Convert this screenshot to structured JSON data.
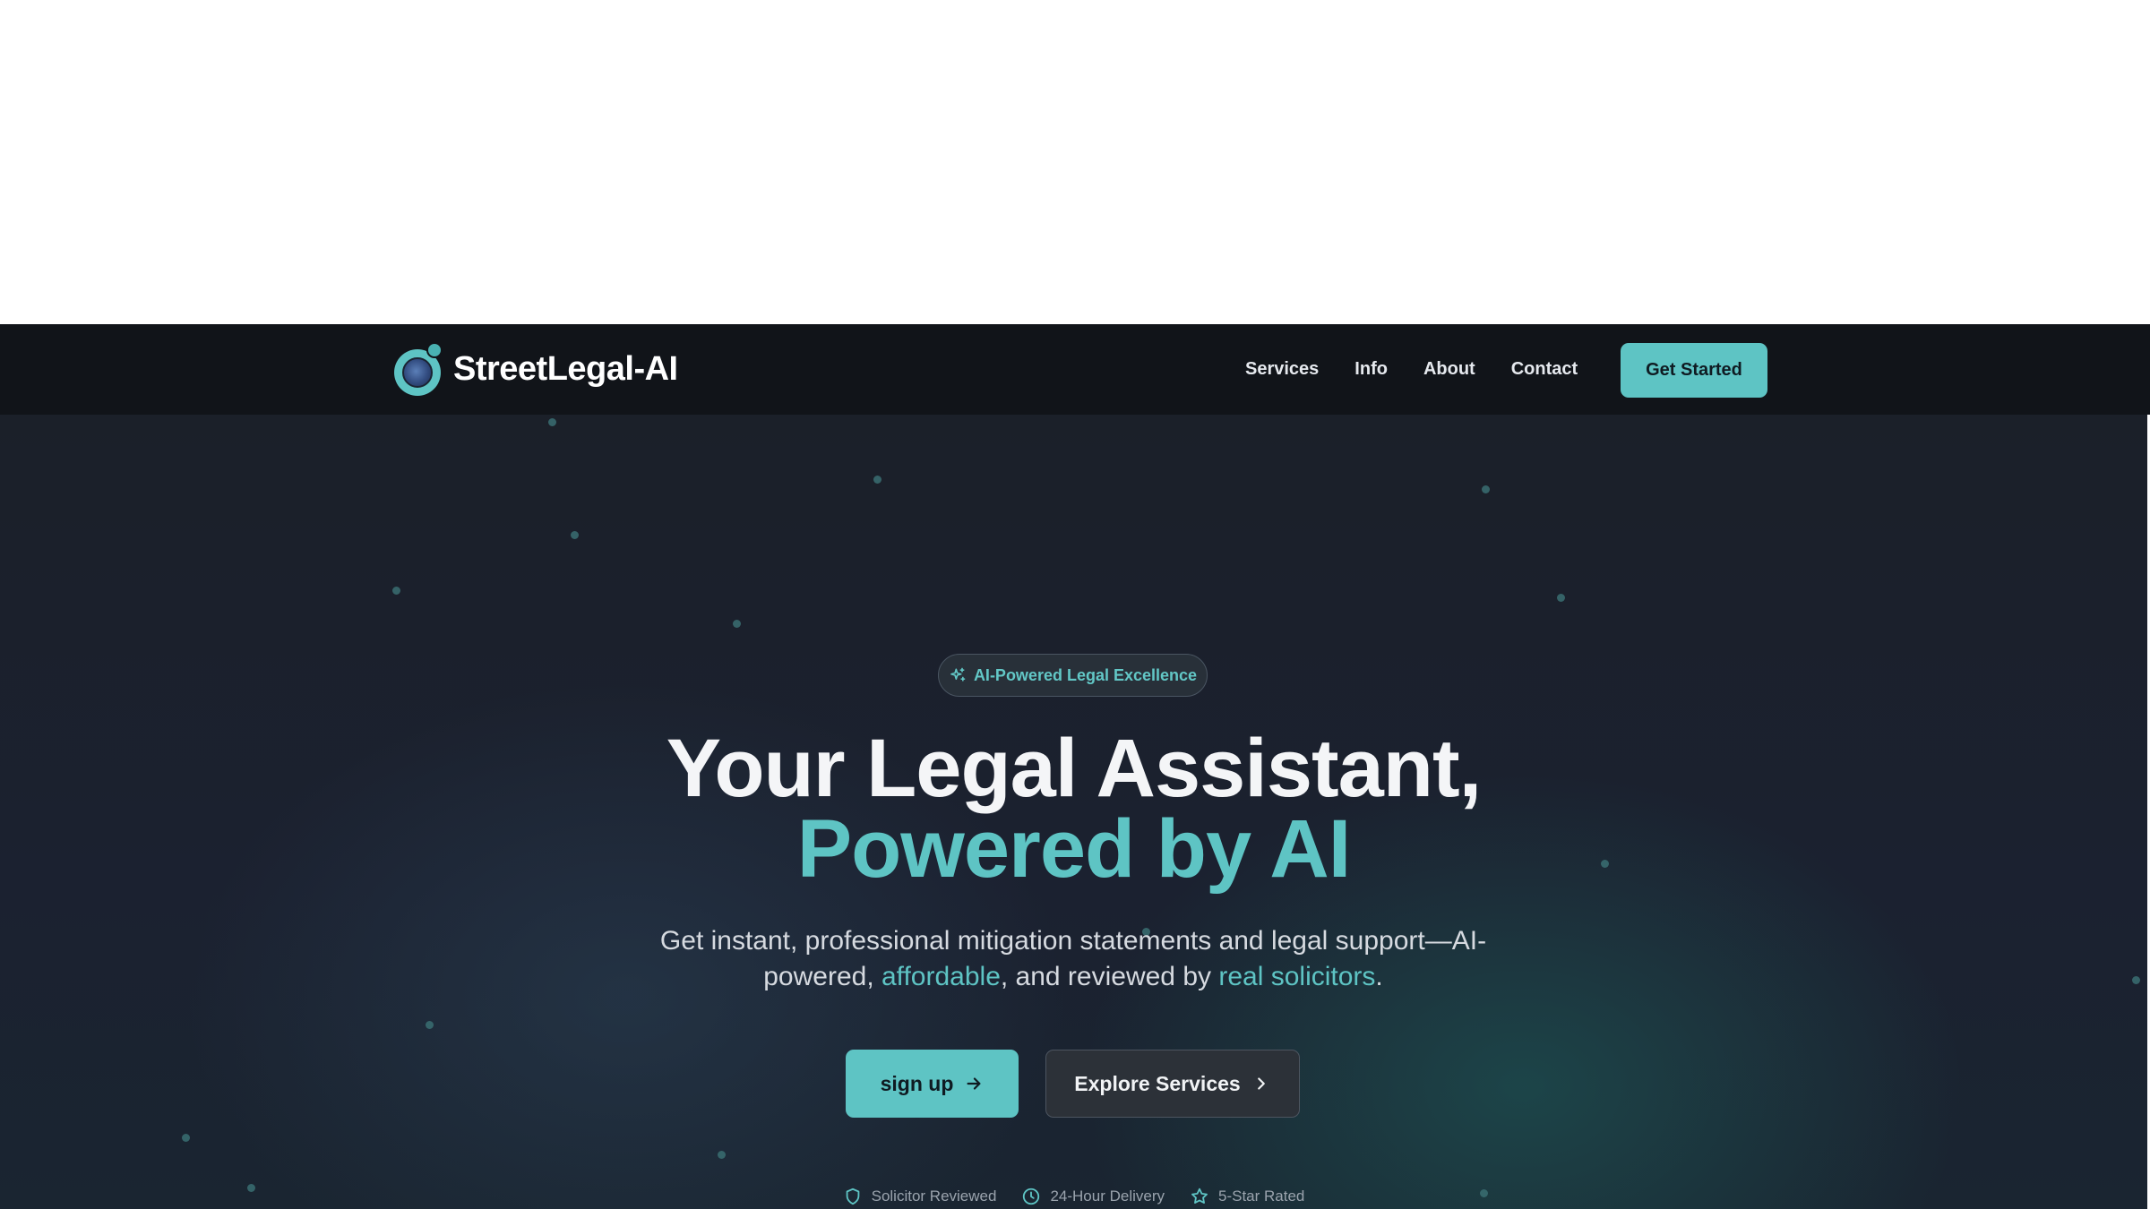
{
  "header": {
    "brand_name": "StreetLegal-AI",
    "nav": [
      "Services",
      "Info",
      "About",
      "Contact"
    ],
    "cta_label": "Get Started"
  },
  "hero": {
    "badge": {
      "icon": "sparkles-icon",
      "text": "AI-Powered Legal Excellence"
    },
    "headline_line1": "Your Legal Assistant,",
    "headline_line2": "Powered by AI",
    "subtitle": {
      "part1": "Get instant, professional mitigation statements and legal support—AI-powered, ",
      "highlight1": "affordable",
      "part2": ", and reviewed by ",
      "highlight2": "real solicitors",
      "part3": "."
    },
    "primary_button": {
      "label": "sign up",
      "icon": "arrow-right-icon"
    },
    "secondary_button": {
      "label": "Explore Services",
      "icon": "chevron-right-icon"
    },
    "trust_items": [
      {
        "icon": "shield-icon",
        "label": "Solicitor Reviewed"
      },
      {
        "icon": "clock-icon",
        "label": "24-Hour Delivery"
      },
      {
        "icon": "star-icon",
        "label": "5-Star Rated"
      }
    ]
  },
  "colors": {
    "accent": "#5ec4c4",
    "nav_background": "#111419",
    "hero_background": "#1b2029",
    "secondary_button_bg": "#2c3138"
  }
}
